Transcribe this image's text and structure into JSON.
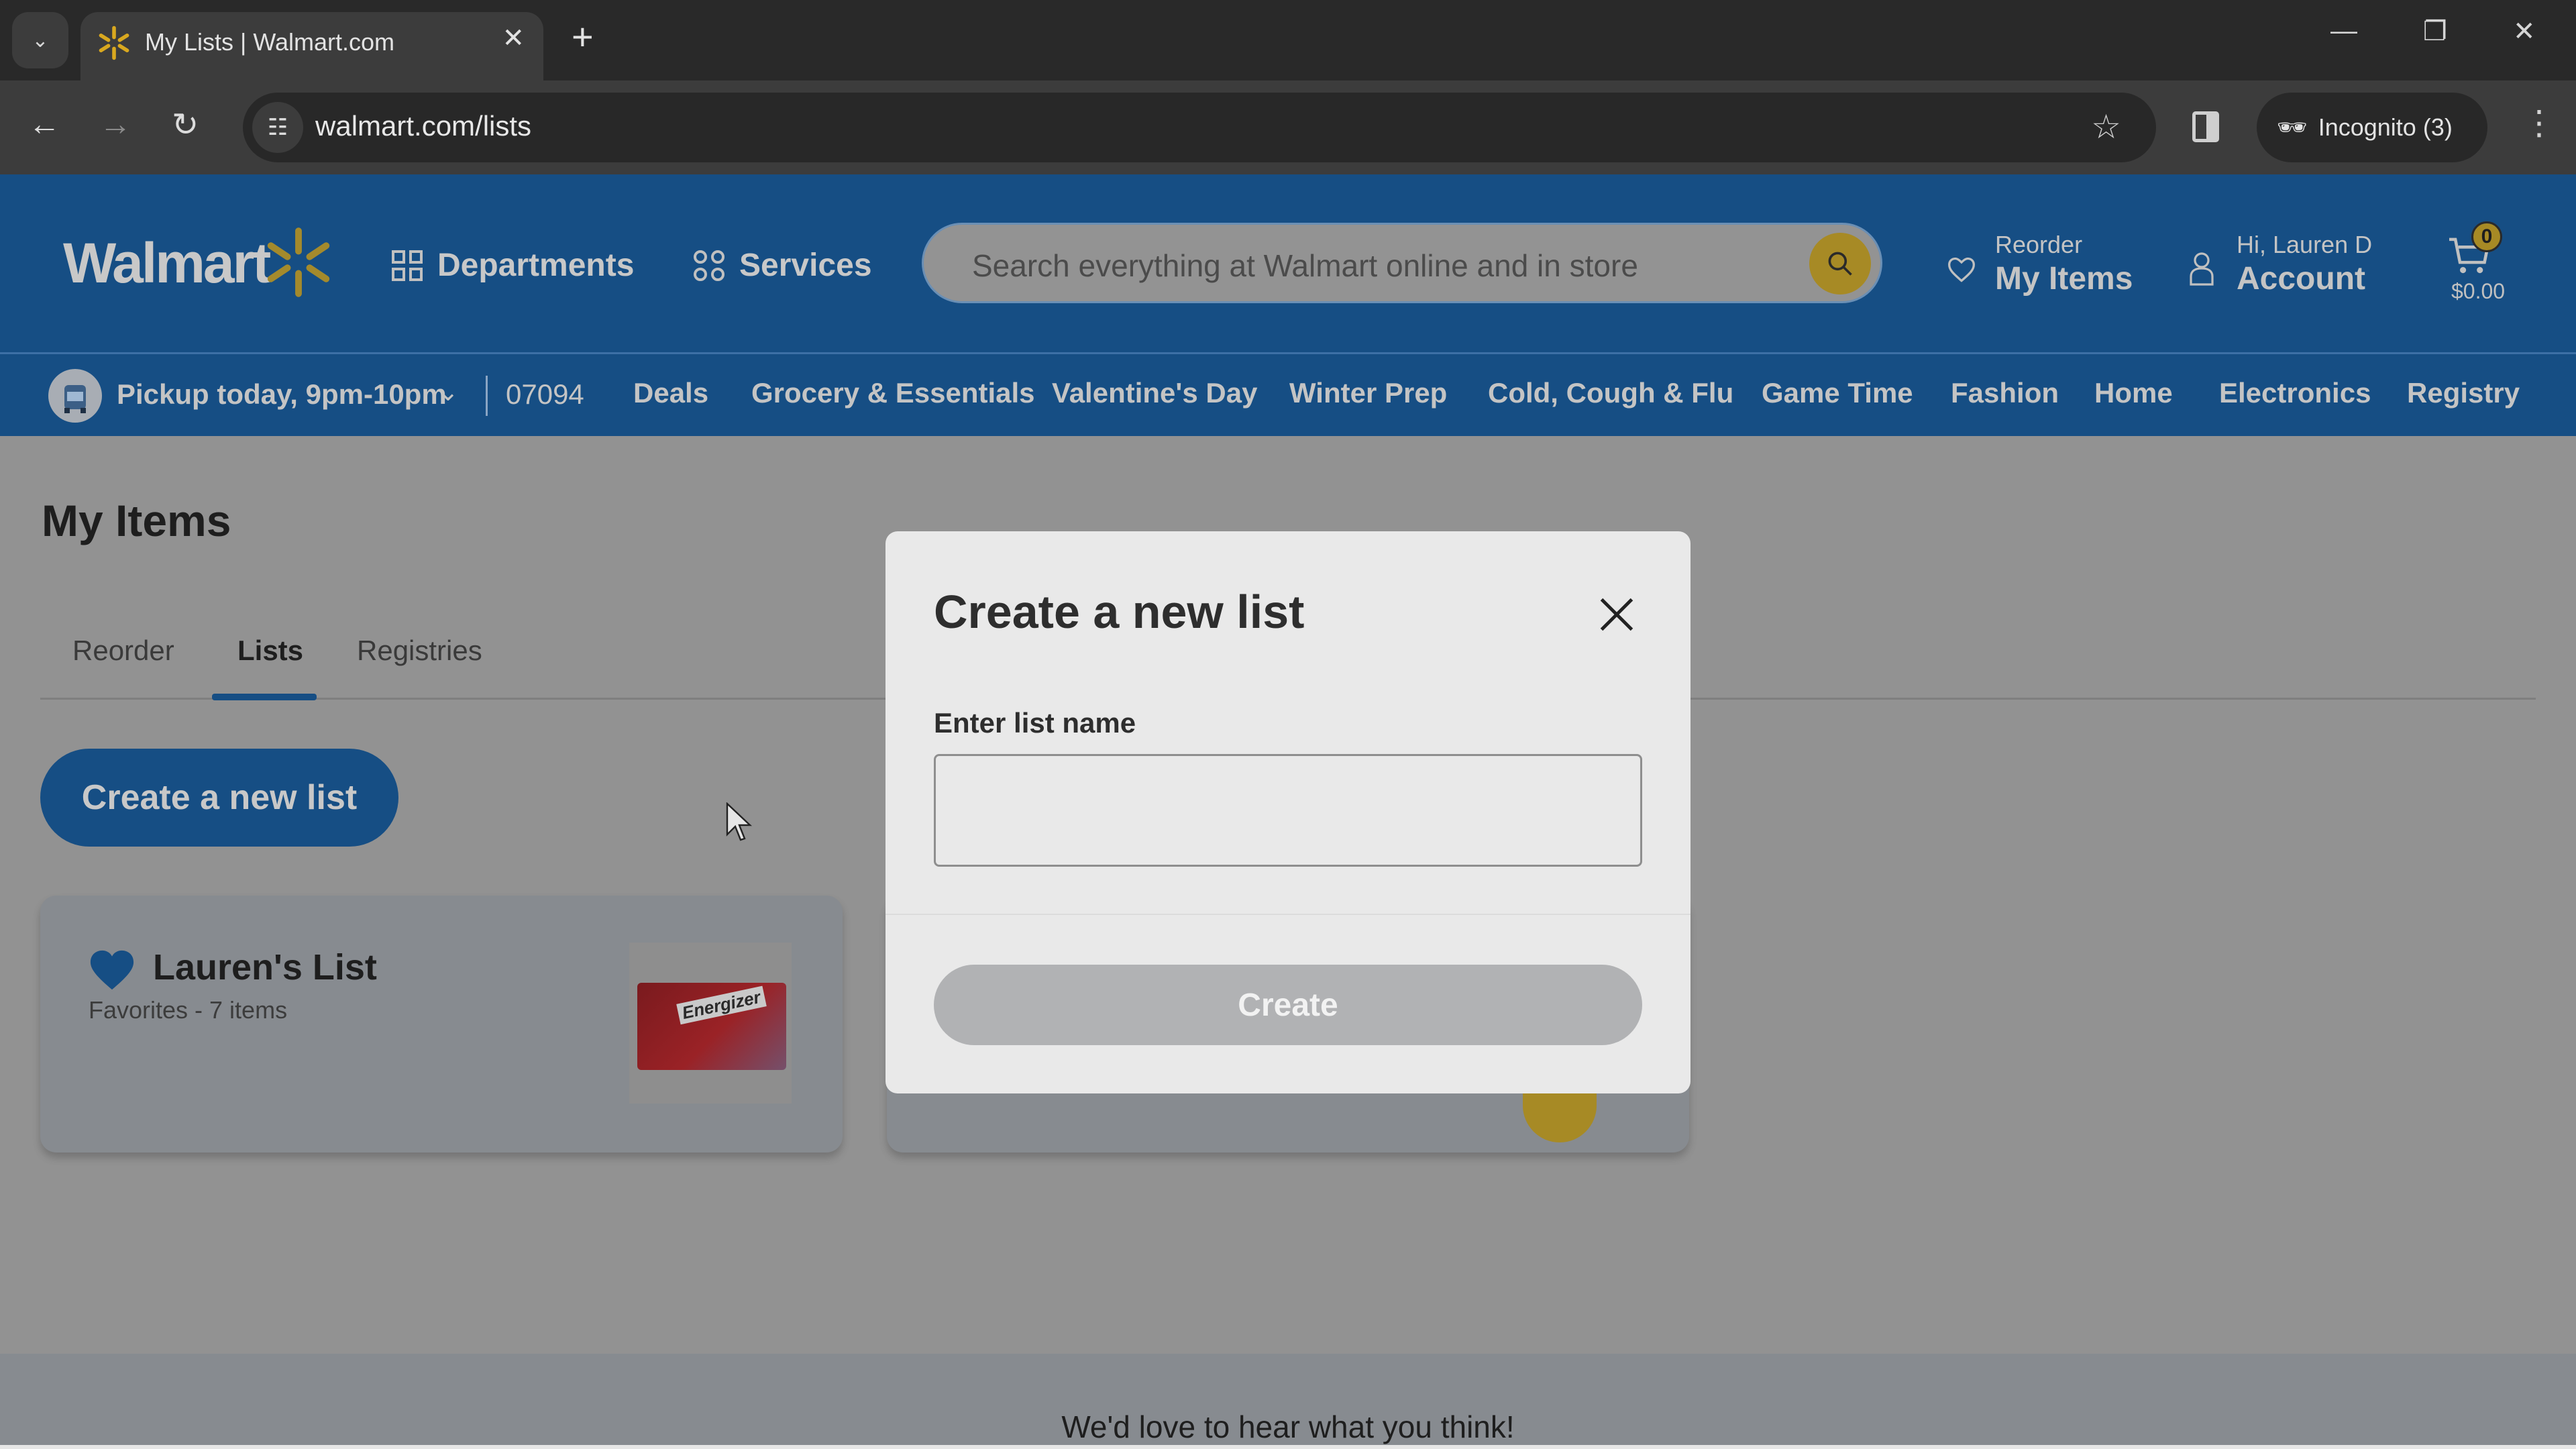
{
  "browser": {
    "tab_title": "My Lists | Walmart.com",
    "url": "walmart.com/lists",
    "incognito_label": "Incognito (3)"
  },
  "header": {
    "logo_text": "Walmart",
    "departments_label": "Departments",
    "services_label": "Services",
    "search_placeholder": "Search everything at Walmart online and in store",
    "reorder_small": "Reorder",
    "reorder_big": "My Items",
    "account_small": "Hi, Lauren D",
    "account_big": "Account",
    "cart_count": "0",
    "cart_total": "$0.00",
    "brand_color": "#0071dc",
    "accent_color": "#ffc220"
  },
  "subnav": {
    "pickup_label": "Pickup today, 9pm-10pm",
    "zip": "07094",
    "items": [
      "Deals",
      "Grocery & Essentials",
      "Valentine's Day",
      "Winter Prep",
      "Cold, Cough & Flu",
      "Game Time",
      "Fashion",
      "Home",
      "Electronics",
      "Registry"
    ]
  },
  "page": {
    "title": "My Items",
    "tabs": [
      {
        "label": "Reorder",
        "active": false
      },
      {
        "label": "Lists",
        "active": true
      },
      {
        "label": "Registries",
        "active": false
      }
    ],
    "create_button": "Create a new list",
    "lists": [
      {
        "name": "Lauren's List",
        "meta": "Favorites - 7 items",
        "thumbnail_brand": "Energizer"
      }
    ],
    "footer_text": "We'd love to hear what you think!"
  },
  "modal": {
    "title": "Create a new list",
    "field_label": "Enter list name",
    "field_value": "",
    "create_label": "Create",
    "create_disabled": true
  }
}
